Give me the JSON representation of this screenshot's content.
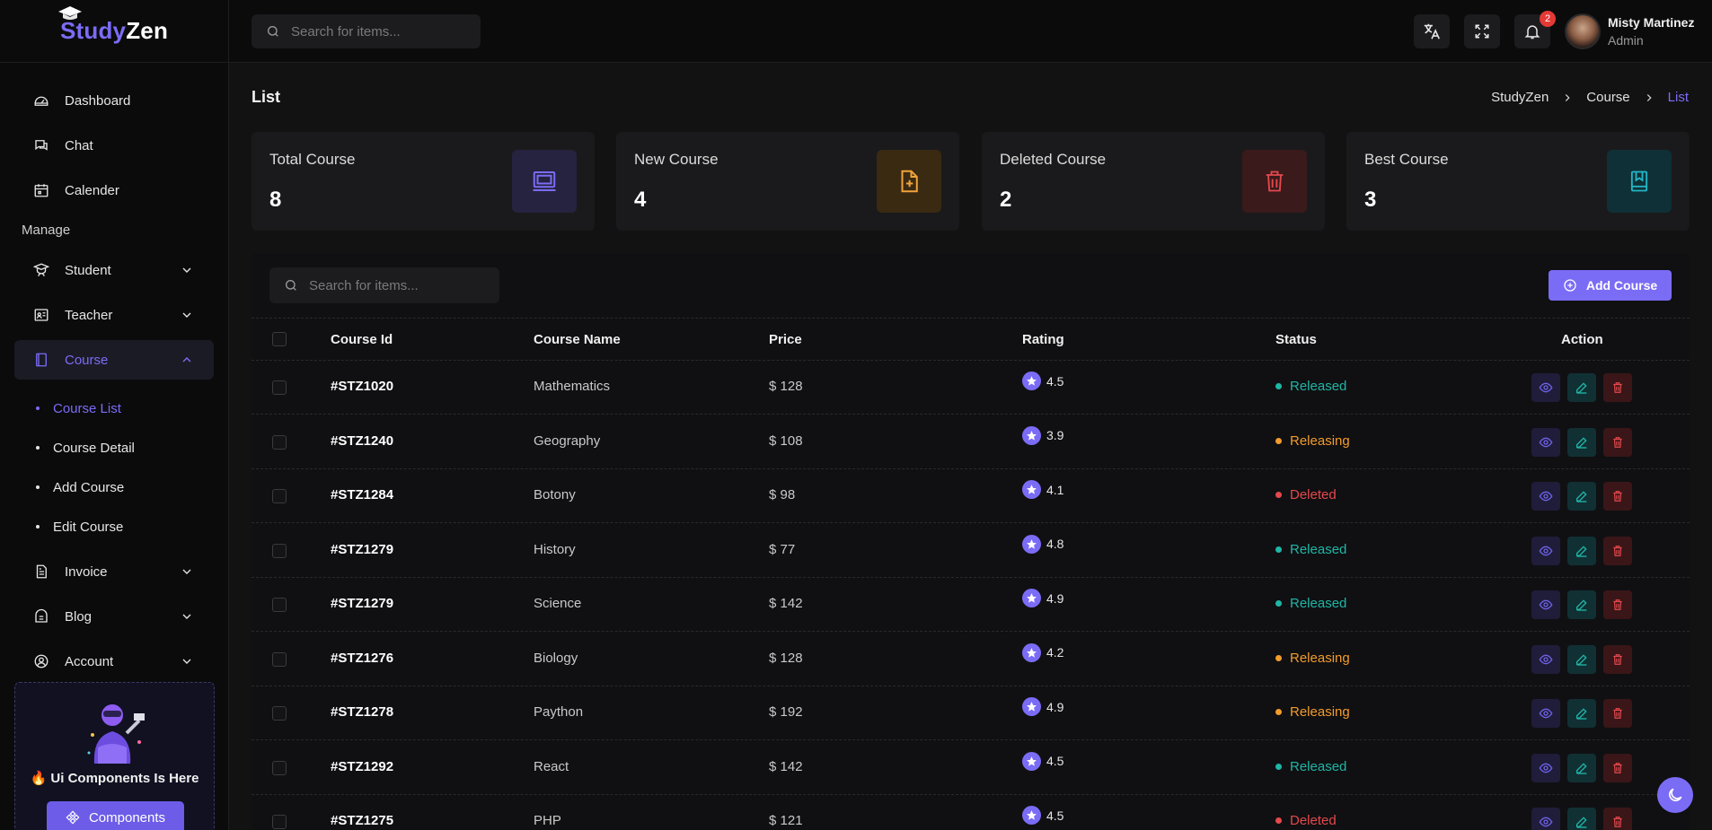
{
  "brand": {
    "name_part1": "Study",
    "name_part2": "Zen"
  },
  "sidebar": {
    "items": [
      {
        "label": "Dashboard",
        "icon": "dashboard-icon"
      },
      {
        "label": "Chat",
        "icon": "chat-icon"
      },
      {
        "label": "Calender",
        "icon": "calendar-icon"
      }
    ],
    "section_label": "Manage",
    "manage_items": [
      {
        "label": "Student",
        "icon": "student-icon"
      },
      {
        "label": "Teacher",
        "icon": "teacher-icon"
      },
      {
        "label": "Course",
        "icon": "course-icon"
      }
    ],
    "course_sub": [
      {
        "label": "Course List"
      },
      {
        "label": "Course Detail"
      },
      {
        "label": "Add Course"
      },
      {
        "label": "Edit Course"
      }
    ],
    "bottom_items": [
      {
        "label": "Invoice",
        "icon": "invoice-icon"
      },
      {
        "label": "Blog",
        "icon": "blog-icon"
      },
      {
        "label": "Account",
        "icon": "account-icon"
      }
    ],
    "promo": {
      "title": "🔥 Ui Components Is Here",
      "button": "Components"
    }
  },
  "topbar": {
    "search_placeholder": "Search for items...",
    "notification_count": "2",
    "user": {
      "name": "Misty Martinez",
      "role": "Admin"
    }
  },
  "page": {
    "title": "List",
    "breadcrumb": [
      "StudyZen",
      "Course",
      "List"
    ]
  },
  "stats": [
    {
      "label": "Total Course",
      "value": "8",
      "color": "#7b6cf6",
      "bg": "#25233f",
      "icon": "chalkboard-icon"
    },
    {
      "label": "New Course",
      "value": "4",
      "color": "#f2a33a",
      "bg": "#3a2a12",
      "icon": "file-plus-icon"
    },
    {
      "label": "Deleted Course",
      "value": "2",
      "color": "#e5484d",
      "bg": "#3a1a1b",
      "icon": "trash-icon"
    },
    {
      "label": "Best Course",
      "value": "3",
      "color": "#23b5c7",
      "bg": "#0f3036",
      "icon": "bookmark-book-icon"
    }
  ],
  "table": {
    "search_placeholder": "Search for items...",
    "add_button": "Add Course",
    "columns": [
      "Course Id",
      "Course Name",
      "Price",
      "Rating",
      "Status",
      "Action"
    ],
    "rows": [
      {
        "id": "#STZ1020",
        "name": "Mathematics",
        "price": "$ 128",
        "rating": "4.5",
        "status": "Released"
      },
      {
        "id": "#STZ1240",
        "name": "Geography",
        "price": "$ 108",
        "rating": "3.9",
        "status": "Releasing"
      },
      {
        "id": "#STZ1284",
        "name": "Botony",
        "price": "$ 98",
        "rating": "4.1",
        "status": "Deleted"
      },
      {
        "id": "#STZ1279",
        "name": "History",
        "price": "$ 77",
        "rating": "4.8",
        "status": "Released"
      },
      {
        "id": "#STZ1279",
        "name": "Science",
        "price": "$ 142",
        "rating": "4.9",
        "status": "Released"
      },
      {
        "id": "#STZ1276",
        "name": "Biology",
        "price": "$ 128",
        "rating": "4.2",
        "status": "Releasing"
      },
      {
        "id": "#STZ1278",
        "name": "Paython",
        "price": "$ 192",
        "rating": "4.9",
        "status": "Releasing"
      },
      {
        "id": "#STZ1292",
        "name": "React",
        "price": "$ 142",
        "rating": "4.5",
        "status": "Released"
      },
      {
        "id": "#STZ1275",
        "name": "PHP",
        "price": "$ 121",
        "rating": "4.5",
        "status": "Deleted"
      }
    ],
    "status_colors": {
      "Released": "#1fb6a6",
      "Releasing": "#f29b2b",
      "Deleted": "#e5484d"
    }
  },
  "colors": {
    "accent": "#7b6cf6",
    "background": "#121212"
  }
}
